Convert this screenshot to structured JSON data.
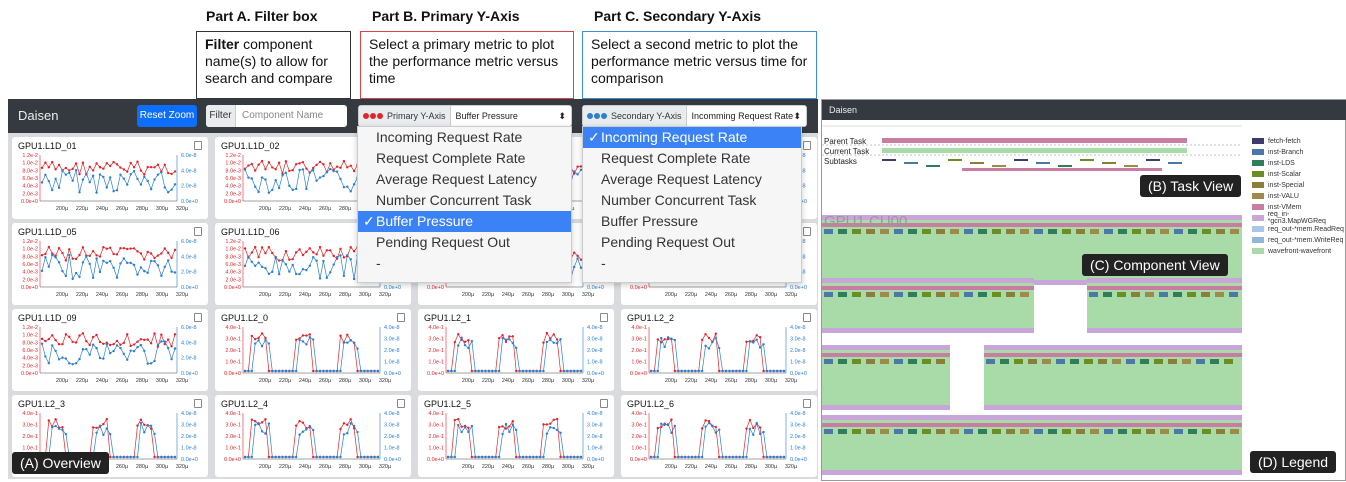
{
  "parts": {
    "a": {
      "title": "Part A. Filter box",
      "bold": "Filter",
      "text": " component name(s) to allow for search and compare"
    },
    "b": {
      "title": "Part B. Primary Y-Axis",
      "text": "Select a primary metric to plot the performance metric versus time"
    },
    "c": {
      "title": "Part C. Secondary Y-Axis",
      "text": "Select a second metric to plot the performance metric versus time for comparison"
    }
  },
  "overview": {
    "brand": "Daisen",
    "reset_label": "Reset Zoom",
    "filter_label": "Filter",
    "filter_placeholder": "Component Name",
    "primary_label": "Primary Y-Axis",
    "primary_value": "Buffer Pressure",
    "secondary_label": "Secondary Y-Axis",
    "secondary_value": "Incomming Request Rate",
    "arrow": "⬍",
    "panels": [
      "GPU1.L1D_01",
      "GPU1.L1D_02",
      "",
      "",
      "GPU1.L1D_05",
      "GPU1.L1D_06",
      "",
      "",
      "GPU1.L1D_09",
      "GPU1.L2_0",
      "GPU1.L2_1",
      "GPU1.L2_2",
      "GPU1.L2_3",
      "GPU1.L2_4",
      "GPU1.L2_5",
      "GPU1.L2_6"
    ],
    "x_ticks": [
      "200µ",
      "220µ",
      "240µ",
      "260µ",
      "280µ",
      "300µ",
      "320µ"
    ],
    "l1_left_ticks": [
      "1.2e-2",
      "1.0e-2",
      "8.0e-3",
      "6.0e-3",
      "4.0e-3",
      "2.0e-3",
      "0.0e+0"
    ],
    "l1_right_ticks": [
      "6.0e-8",
      "4.0e-8",
      "2.0e-8",
      "0.0e+0"
    ],
    "l2_left_ticks": [
      "4.0e-1",
      "3.0e-1",
      "2.0e-1",
      "1.0e-1",
      "0.0e+0"
    ],
    "l2_right_ticks": [
      "4.0e-8",
      "3.0e-8",
      "2.0e-8",
      "1.0e-8",
      "0.0e+0"
    ],
    "tag": "(A) Overview"
  },
  "primary_menu": {
    "items": [
      "Incoming Request Rate",
      "Request Complete Rate",
      "Average Request Latency",
      "Number Concurrent Task",
      "Buffer Pressure",
      "Pending Request Out",
      "-"
    ],
    "selected": 4
  },
  "secondary_menu": {
    "items": [
      "Incoming Request Rate",
      "Request Complete Rate",
      "Average Request Latency",
      "Number Concurrent Task",
      "Buffer Pressure",
      "Pending Request Out",
      "-"
    ],
    "selected": 0
  },
  "taskview": {
    "brand": "Daisen",
    "parent_task": "Parent Task",
    "current_task": "Current Task",
    "subtasks": "Subtasks",
    "component": "GPU1.CU00",
    "tag_task": "(B) Task View",
    "tag_component": "(C) Component View",
    "tag_legend": "(D) Legend",
    "legend": [
      {
        "name": "fetch-fetch",
        "color": "#3b3b6e"
      },
      {
        "name": "inst-Branch",
        "color": "#4c78a8"
      },
      {
        "name": "inst-LDS",
        "color": "#2f7d5a"
      },
      {
        "name": "inst-Scalar",
        "color": "#6b8e23"
      },
      {
        "name": "inst-Special",
        "color": "#8b7d3a"
      },
      {
        "name": "inst-VALU",
        "color": "#a08a4a"
      },
      {
        "name": "inst-VMem",
        "color": "#c77ea0"
      },
      {
        "name": "req_in-*gcn3.MapWGReq",
        "color": "#c9a6d9"
      },
      {
        "name": "req_out-*mem.ReadReq",
        "color": "#a9c8e8"
      },
      {
        "name": "req_out-*mem.WriteReq",
        "color": "#8fb8d6"
      },
      {
        "name": "wavefront-wavefront",
        "color": "#a8dba8"
      }
    ]
  },
  "colors": {
    "primary": "#e0262b",
    "secondary": "#2a7fd0"
  }
}
